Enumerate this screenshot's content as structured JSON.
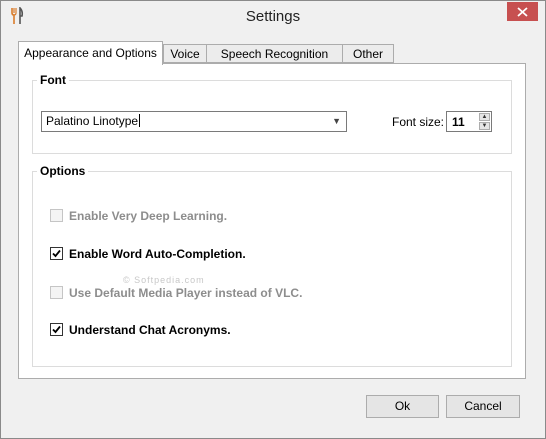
{
  "window": {
    "title": "Settings",
    "app_icon": "fork-knife-icon",
    "close_icon": "close-icon",
    "close_color": "#c75050"
  },
  "tabs": [
    {
      "label": "Appearance and Options",
      "active": true
    },
    {
      "label": "Voice",
      "active": false
    },
    {
      "label": "Speech Recognition",
      "active": false
    },
    {
      "label": "Other",
      "active": false
    }
  ],
  "font_group": {
    "title": "Font",
    "font_value": "Palatino Linotype",
    "font_size_label": "Font size:",
    "font_size_value": "11"
  },
  "options_group": {
    "title": "Options",
    "items": [
      {
        "label": "Enable Very Deep Learning.",
        "checked": false,
        "enabled": false
      },
      {
        "label": "Enable Word Auto-Completion.",
        "checked": true,
        "enabled": true
      },
      {
        "label": "Use Default Media Player instead of VLC.",
        "checked": false,
        "enabled": false
      },
      {
        "label": "Understand Chat Acronyms.",
        "checked": true,
        "enabled": true
      }
    ]
  },
  "watermark": "© Softpedia.com",
  "buttons": {
    "ok": "Ok",
    "cancel": "Cancel"
  }
}
